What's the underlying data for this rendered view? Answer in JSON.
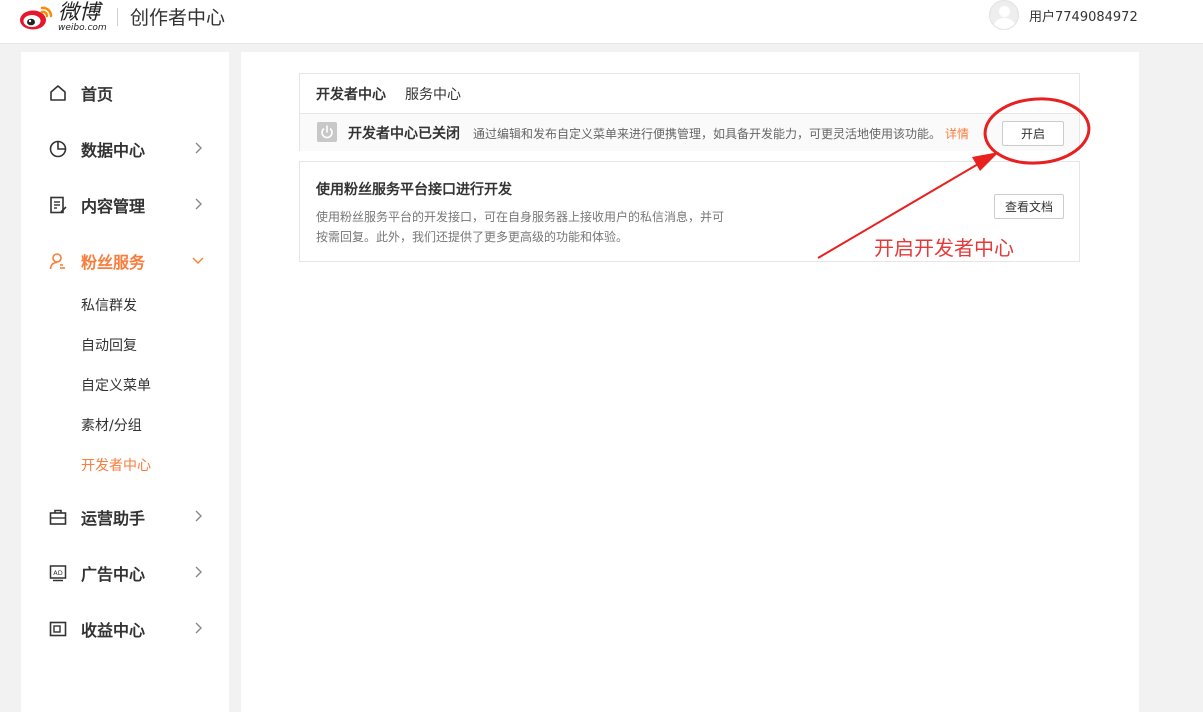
{
  "header": {
    "logo_cn": "微博",
    "logo_en": "weibo.com",
    "app_title": "创作者中心",
    "user_name": "用户7749084972"
  },
  "sidebar": {
    "items": [
      {
        "label": "首页",
        "icon": "home-icon"
      },
      {
        "label": "数据中心",
        "icon": "pie-chart-icon"
      },
      {
        "label": "内容管理",
        "icon": "document-edit-icon"
      },
      {
        "label": "粉丝服务",
        "icon": "user-icon",
        "expanded": true
      },
      {
        "label": "运营助手",
        "icon": "briefcase-icon"
      },
      {
        "label": "广告中心",
        "icon": "ad-icon"
      },
      {
        "label": "收益中心",
        "icon": "wallet-icon"
      }
    ],
    "fan_service_subitems": [
      "私信群发",
      "自动回复",
      "自定义菜单",
      "素材/分组",
      "开发者中心"
    ]
  },
  "main": {
    "tabs": [
      "开发者中心",
      "服务中心"
    ],
    "status": {
      "title": "开发者中心已关闭",
      "description": "通过编辑和发布自定义菜单来进行便携管理，如具备开发能力，可更灵活地使用该功能。",
      "detail_link": "详情",
      "open_button": "开启"
    },
    "api_card": {
      "title": "使用粉丝服务平台接口进行开发",
      "desc_line1": "使用粉丝服务平台的开发接口，可在自身服务器上接收用户的私信消息，并可",
      "desc_line2": "按需回复。此外，我们还提供了更多更高级的功能和体验。",
      "doc_button": "查看文档"
    }
  },
  "annotation": {
    "text": "开启开发者中心"
  },
  "colors": {
    "accent": "#fa7d3c",
    "annotation_red": "#e53a3a",
    "background": "#f2f2f2"
  }
}
